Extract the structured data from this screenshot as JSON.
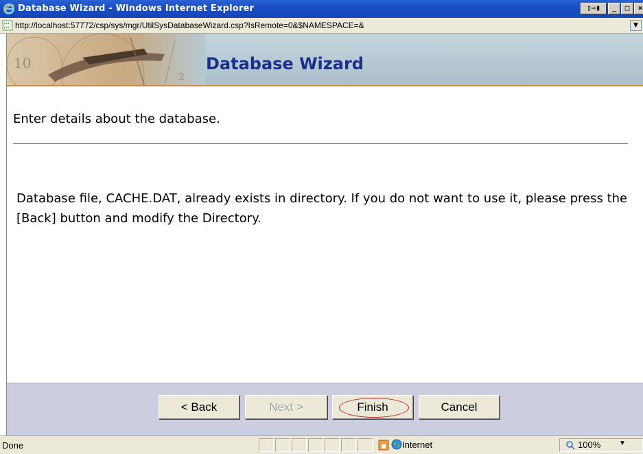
{
  "window": {
    "title": "Database Wizard - Windows Internet Explorer",
    "switch_label": "▯⇨▮",
    "min_label": "_",
    "max_label": "□",
    "close_label": "×"
  },
  "address": {
    "url": "http://localhost:57772/csp/sys/mgr/UtilSysDatabaseWizard.csp?IsRemote=0&$NAMESPACE=&",
    "dropdown_label": "▼"
  },
  "header": {
    "title": "Database Wizard"
  },
  "body": {
    "intro": "Enter details about the database.",
    "message": "Database file, CACHE.DAT, already exists in directory. If you do not want to use it, please press the [Back] button and modify the Directory."
  },
  "buttons": {
    "back": "< Back",
    "next": "Next >",
    "finish": "Finish",
    "cancel": "Cancel"
  },
  "statusbar": {
    "status": "Done",
    "zone": "Internet",
    "zoom": "100%",
    "zoom_arrow": "▼"
  },
  "colors": {
    "titlebar": "#1a4fc4",
    "header_title": "#1a2f8a",
    "rule": "#3b8aa8",
    "footer": "#cdcde0",
    "finish_highlight": "#d02020"
  }
}
